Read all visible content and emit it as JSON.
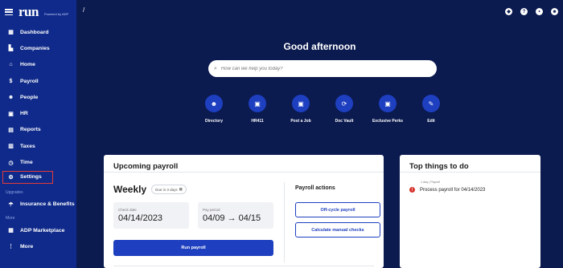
{
  "brand": {
    "logo": "run",
    "sub": "Powered by ADP"
  },
  "sidebar": {
    "items": [
      {
        "label": "Dashboard",
        "icon": "grid-icon",
        "glyph": "▦"
      },
      {
        "label": "Companies",
        "icon": "building-icon",
        "glyph": "▙"
      },
      {
        "label": "Home",
        "icon": "home-icon",
        "glyph": "⌂"
      },
      {
        "label": "Payroll",
        "icon": "dollar-icon",
        "glyph": "$"
      },
      {
        "label": "People",
        "icon": "people-icon",
        "glyph": "☻"
      },
      {
        "label": "HR",
        "icon": "briefcase-icon",
        "glyph": "▣"
      },
      {
        "label": "Reports",
        "icon": "reports-icon",
        "glyph": "▤"
      },
      {
        "label": "Taxes",
        "icon": "taxes-icon",
        "glyph": "▥"
      },
      {
        "label": "Time",
        "icon": "clock-icon",
        "glyph": "◷"
      },
      {
        "label": "Settings",
        "icon": "gear-icon",
        "glyph": "⚙"
      }
    ],
    "section_upgrades": "Upgrades",
    "insurance": {
      "label": "Insurance & Benefits",
      "glyph": "☂"
    },
    "section_more": "More",
    "marketplace": {
      "label": "ADP Marketplace",
      "glyph": "▦"
    },
    "more": {
      "label": "More",
      "glyph": "⋮"
    }
  },
  "header": {
    "slash": "/",
    "greeting": "Good afternoon",
    "search_placeholder": "How can we help you today?"
  },
  "quick_links": [
    {
      "label": "Directory",
      "icon": "directory-icon",
      "glyph": "☻"
    },
    {
      "label": "HR411",
      "icon": "hr411-icon",
      "glyph": "▣"
    },
    {
      "label": "Post a Job",
      "icon": "post-job-icon",
      "glyph": "▣"
    },
    {
      "label": "Doc Vault",
      "icon": "doc-vault-icon",
      "glyph": "⟳"
    },
    {
      "label": "Exclusive Perks",
      "icon": "gift-icon",
      "glyph": "▣"
    },
    {
      "label": "Edit",
      "icon": "pencil-icon",
      "glyph": "✎"
    }
  ],
  "upcoming": {
    "title": "Upcoming payroll",
    "frequency": "Weekly",
    "due": "Due in 3 days",
    "check_date_label": "Check date",
    "check_date": "04/14/2023",
    "pay_period_label": "Pay period",
    "pay_period": "04/09 → 04/15",
    "run_label": "Run payroll",
    "actions_title": "Payroll actions",
    "off_cycle": "Off-cycle payroll",
    "manual_checks": "Calculate manual checks"
  },
  "todo": {
    "title": "Top things to do",
    "meta": "1 day | Payroll",
    "item": "Process payroll for 04/14/2023"
  }
}
